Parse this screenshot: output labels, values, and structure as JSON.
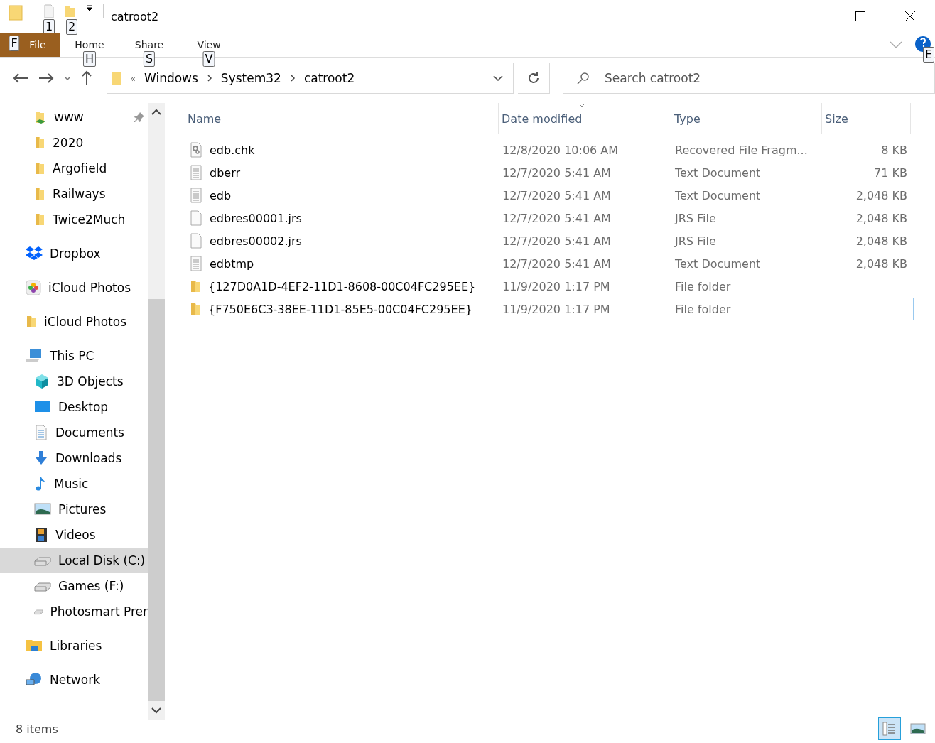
{
  "window": {
    "title": "catroot2",
    "keytips": [
      "1",
      "2"
    ]
  },
  "ribbon": {
    "tabs": [
      {
        "label": "File",
        "keytip": "F",
        "selected": true
      },
      {
        "label": "Home",
        "keytip": "H",
        "selected": false
      },
      {
        "label": "Share",
        "keytip": "S",
        "selected": false
      },
      {
        "label": "View",
        "keytip": "V",
        "selected": false
      }
    ],
    "help_keytip": "E"
  },
  "address": {
    "overflow": "«",
    "crumbs": [
      "Windows",
      "System32",
      "catroot2"
    ]
  },
  "search": {
    "placeholder": "Search catroot2"
  },
  "sidebar": {
    "groups": [
      {
        "items": [
          {
            "label": "www",
            "kind": "folder-link",
            "pinned": true,
            "selected": false
          },
          {
            "label": "2020",
            "kind": "folder",
            "selected": false
          },
          {
            "label": "Argofield",
            "kind": "folder",
            "selected": false
          },
          {
            "label": "Railways",
            "kind": "folder",
            "selected": false
          },
          {
            "label": "Twice2Much",
            "kind": "folder",
            "selected": false
          }
        ]
      },
      {
        "items": [
          {
            "label": "Dropbox",
            "kind": "dropbox",
            "selected": false
          }
        ]
      },
      {
        "items": [
          {
            "label": "iCloud Photos",
            "kind": "photos",
            "selected": false
          }
        ]
      },
      {
        "items": [
          {
            "label": "iCloud Photos",
            "kind": "folder",
            "selected": false
          }
        ]
      },
      {
        "items": [
          {
            "label": "This PC",
            "kind": "pc",
            "selected": false,
            "children": [
              {
                "label": "3D Objects",
                "kind": "cube",
                "selected": false
              },
              {
                "label": "Desktop",
                "kind": "desktop",
                "selected": false
              },
              {
                "label": "Documents",
                "kind": "document",
                "selected": false
              },
              {
                "label": "Downloads",
                "kind": "download",
                "selected": false
              },
              {
                "label": "Music",
                "kind": "music",
                "selected": false
              },
              {
                "label": "Pictures",
                "kind": "pictures",
                "selected": false
              },
              {
                "label": "Videos",
                "kind": "videos",
                "selected": false
              },
              {
                "label": "Local Disk (C:)",
                "kind": "drive",
                "selected": true
              },
              {
                "label": "Games (F:)",
                "kind": "drive",
                "selected": false
              },
              {
                "label": "Photosmart Prer",
                "kind": "drive",
                "selected": false
              }
            ]
          }
        ]
      },
      {
        "items": [
          {
            "label": "Libraries",
            "kind": "libraries",
            "selected": false
          }
        ]
      },
      {
        "items": [
          {
            "label": "Network",
            "kind": "network",
            "selected": false
          }
        ]
      }
    ]
  },
  "table": {
    "columns": [
      "Name",
      "Date modified",
      "Type",
      "Size"
    ],
    "rows": [
      {
        "kind": "config",
        "name": "edb.chk",
        "date": "12/8/2020 10:06 AM",
        "type": "Recovered File Fragm...",
        "size": "8 KB",
        "focused": false
      },
      {
        "kind": "text",
        "name": "dberr",
        "date": "12/7/2020 5:41 AM",
        "type": "Text Document",
        "size": "71 KB",
        "focused": false
      },
      {
        "kind": "text",
        "name": "edb",
        "date": "12/7/2020 5:41 AM",
        "type": "Text Document",
        "size": "2,048 KB",
        "focused": false
      },
      {
        "kind": "blank",
        "name": "edbres00001.jrs",
        "date": "12/7/2020 5:41 AM",
        "type": "JRS File",
        "size": "2,048 KB",
        "focused": false
      },
      {
        "kind": "blank",
        "name": "edbres00002.jrs",
        "date": "12/7/2020 5:41 AM",
        "type": "JRS File",
        "size": "2,048 KB",
        "focused": false
      },
      {
        "kind": "text",
        "name": "edbtmp",
        "date": "12/7/2020 5:41 AM",
        "type": "Text Document",
        "size": "2,048 KB",
        "focused": false
      },
      {
        "kind": "folder",
        "name": "{127D0A1D-4EF2-11D1-8608-00C04FC295EE}",
        "date": "11/9/2020 1:17 PM",
        "type": "File folder",
        "focused": false
      },
      {
        "kind": "folder",
        "name": "{F750E6C3-38EE-11D1-85E5-00C04FC295EE}",
        "date": "11/9/2020 1:17 PM",
        "type": "File folder",
        "focused": true
      }
    ]
  },
  "status_bar": {
    "count": "8 items",
    "views": [
      {
        "kind": "details",
        "selected": true
      },
      {
        "kind": "thumbnails",
        "selected": false
      }
    ]
  }
}
